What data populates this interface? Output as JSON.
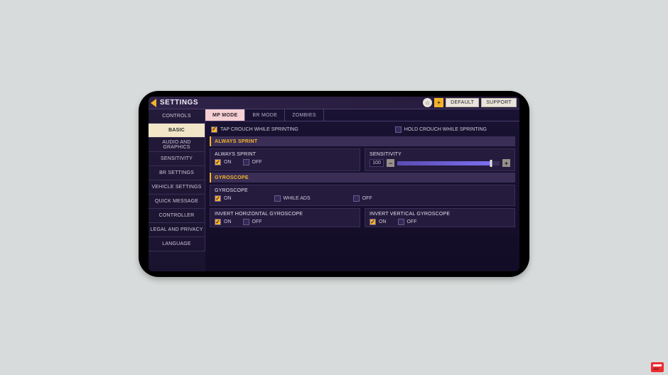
{
  "header": {
    "title": "SETTINGS",
    "plus": "+",
    "home_icon": "⌂",
    "default": "DEFAULT",
    "support": "SUPPORT"
  },
  "sidebar": {
    "items": [
      {
        "label": "CONTROLS",
        "active": false
      },
      {
        "label": "BASIC",
        "active": true
      },
      {
        "label": "AUDIO AND GRAPHICS",
        "active": false
      },
      {
        "label": "SENSITIVITY",
        "active": false
      },
      {
        "label": "BR SETTINGS",
        "active": false
      },
      {
        "label": "VEHICLE SETTINGS",
        "active": false
      },
      {
        "label": "QUICK MESSAGE",
        "active": false
      },
      {
        "label": "CONTROLLER",
        "active": false
      },
      {
        "label": "LEGAL AND PRIVACY",
        "active": false
      },
      {
        "label": "LANGUAGE",
        "active": false
      }
    ]
  },
  "tabs": [
    {
      "label": "MP MODE",
      "active": true
    },
    {
      "label": "BR MODE",
      "active": false
    },
    {
      "label": "ZOMBIES",
      "active": false
    }
  ],
  "crouch": {
    "tap": {
      "label": "TAP CROUCH WHILE SPRINTING",
      "checked": true
    },
    "hold": {
      "label": "HOLD CROUCH WHILE SPRINTING",
      "checked": false
    }
  },
  "sections": {
    "always_sprint": {
      "header": "ALWAYS SPRINT",
      "label": "ALWAYS SPRINT",
      "on": "ON",
      "off": "OFF",
      "value": "on",
      "sens_label": "SENSITIVITY",
      "sens_value": "100",
      "minus": "−",
      "plus": "+"
    },
    "gyroscope": {
      "header": "GYROSCOPE",
      "label": "GYROSCOPE",
      "on": "ON",
      "while_ads": "WHILE ADS",
      "off": "OFF",
      "value": "on",
      "invert_h": {
        "label": "INVERT HORIZONTAL GYROSCOPE",
        "on": "ON",
        "off": "OFF",
        "value": "on"
      },
      "invert_v": {
        "label": "INVERT VERTICAL GYROSCOPE",
        "on": "ON",
        "off": "OFF",
        "value": "on"
      }
    }
  }
}
